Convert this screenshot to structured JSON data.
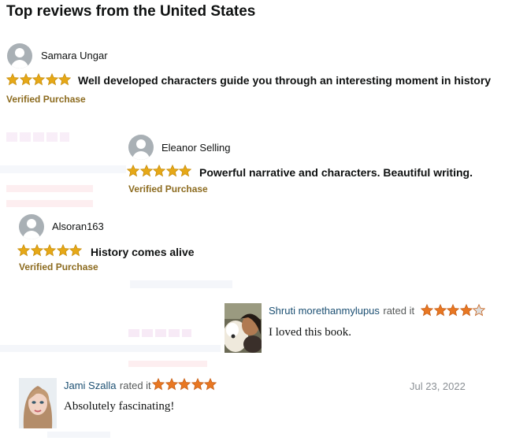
{
  "heading": "Top reviews from the United States",
  "reviews": [
    {
      "name": "Samara Ungar",
      "rating": 5,
      "title": "Well developed characters guide you through an interesting moment in history",
      "verified": "Verified Purchase"
    },
    {
      "name": "Eleanor Selling",
      "rating": 5,
      "title": "Powerful narrative and characters. Beautiful writing.",
      "verified": "Verified Purchase"
    },
    {
      "name": "Alsoran163",
      "rating": 5,
      "title": "History comes alive",
      "verified": "Verified Purchase"
    }
  ],
  "comments": [
    {
      "name": "Shruti morethanmylupus",
      "rated_text": "rated it",
      "rating": 4,
      "text": "I loved this book."
    },
    {
      "name": "Jami Szalla",
      "rated_text": "rated it",
      "rating": 5,
      "text": "Absolutely fascinating!",
      "date": "Jul 23, 2022"
    }
  ],
  "colors": {
    "star": "#e6a817",
    "star_outline": "#c98f0c",
    "goodreads_star": "#e87722",
    "verified": "#8c6b1f"
  }
}
